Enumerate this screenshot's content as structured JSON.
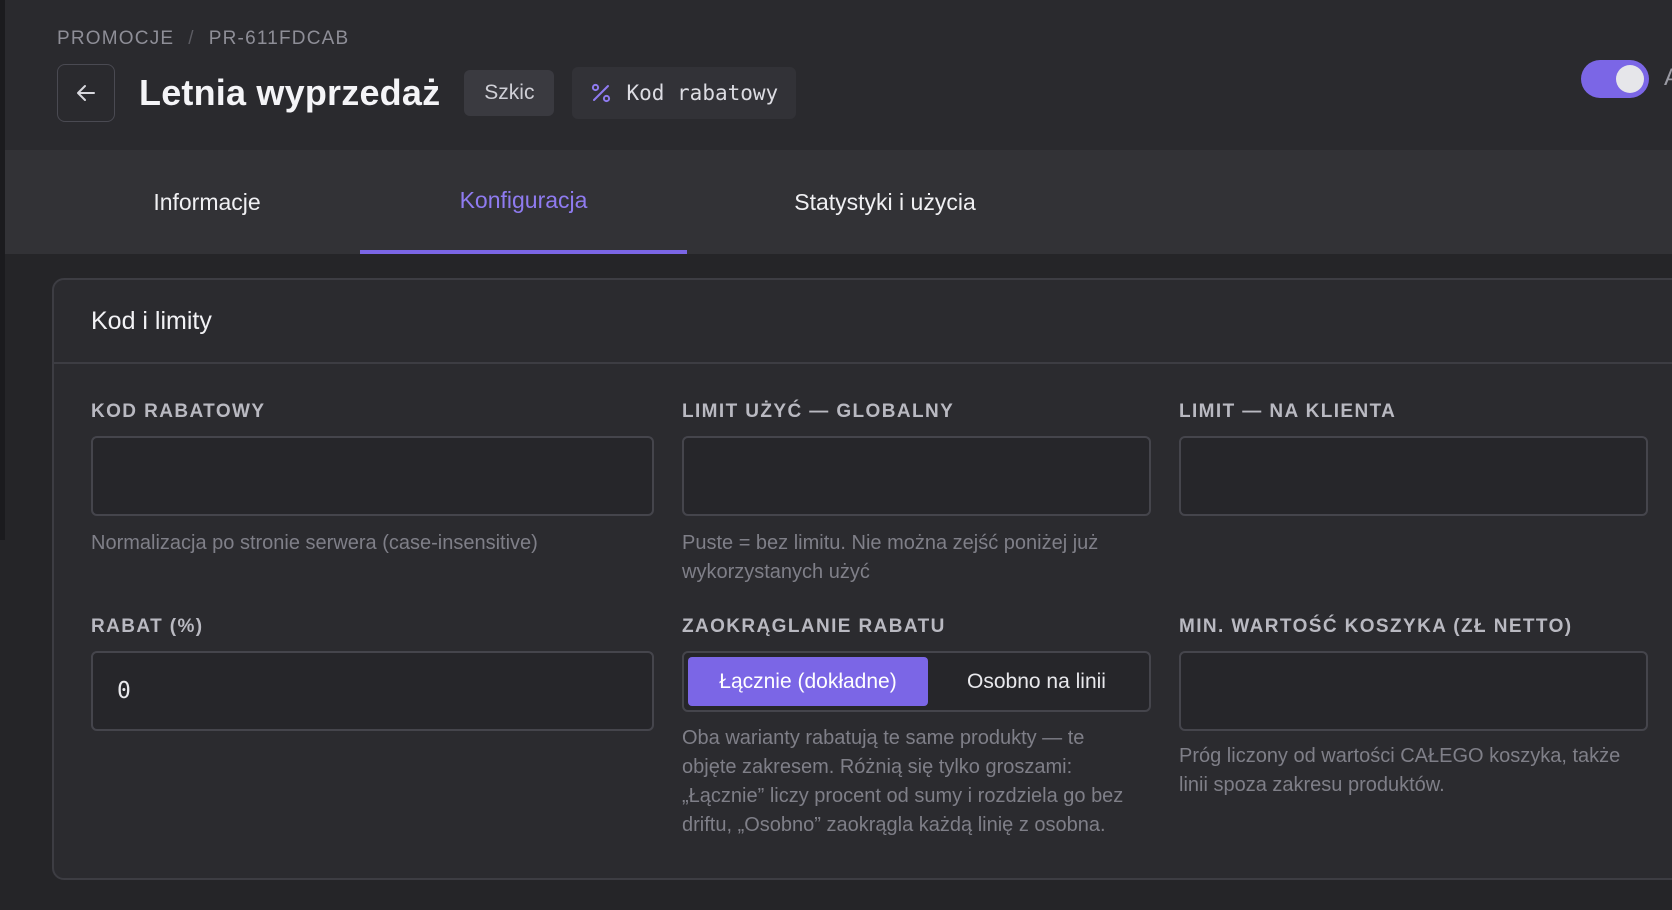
{
  "breadcrumb": {
    "section": "PROMOCJE",
    "separator": "/",
    "id": "PR-611FDCAB"
  },
  "header": {
    "title": "Letnia wyprzedaż",
    "status": "Szkic",
    "type_label": "Kod rabatowy",
    "active_toggle": true,
    "toggle_label_stub": "A"
  },
  "tabs": [
    {
      "label": "Informacje",
      "active": false
    },
    {
      "label": "Konfiguracja",
      "active": true
    },
    {
      "label": "Statystyki i użycia",
      "active": false
    }
  ],
  "card": {
    "title": "Kod i limity",
    "fields": {
      "code": {
        "label": "KOD RABATOWY",
        "value": "",
        "hint": "Normalizacja po stronie serwera (case-insensitive)"
      },
      "global_limit": {
        "label": "LIMIT UŻYĆ — GLOBALNY",
        "value": "",
        "hint_line1": "Puste = bez limitu. Nie można zejść poniżej już",
        "hint_line2": "wykorzystanych użyć"
      },
      "client_limit": {
        "label": "LIMIT — NA KLIENTA",
        "value": ""
      },
      "discount": {
        "label": "RABAT (%)",
        "value": "0"
      },
      "rounding": {
        "label": "ZAOKRĄGLANIE RABATU",
        "options": [
          "Łącznie (dokładne)",
          "Osobno na linii"
        ],
        "selected": "Łącznie (dokładne)",
        "hint_lines": [
          "Oba warianty rabatują te same produkty — te",
          "objęte zakresem. Różnią się tylko groszami:",
          "„Łącznie” liczy procent od sumy i rozdziela go bez",
          "driftu, „Osobno” zaokrągla każdą linię z osobna."
        ]
      },
      "min_cart": {
        "label": "MIN. WARTOŚĆ KOSZYKA (ZŁ NETTO)",
        "value": "",
        "hint_lines": [
          "Próg liczony od wartości CAŁEGO koszyka, także",
          "linii spoza zakresu produktów."
        ]
      }
    }
  },
  "colors": {
    "accent": "#7b66e6",
    "accent_text": "#8f7bf0",
    "background": "#252528"
  }
}
